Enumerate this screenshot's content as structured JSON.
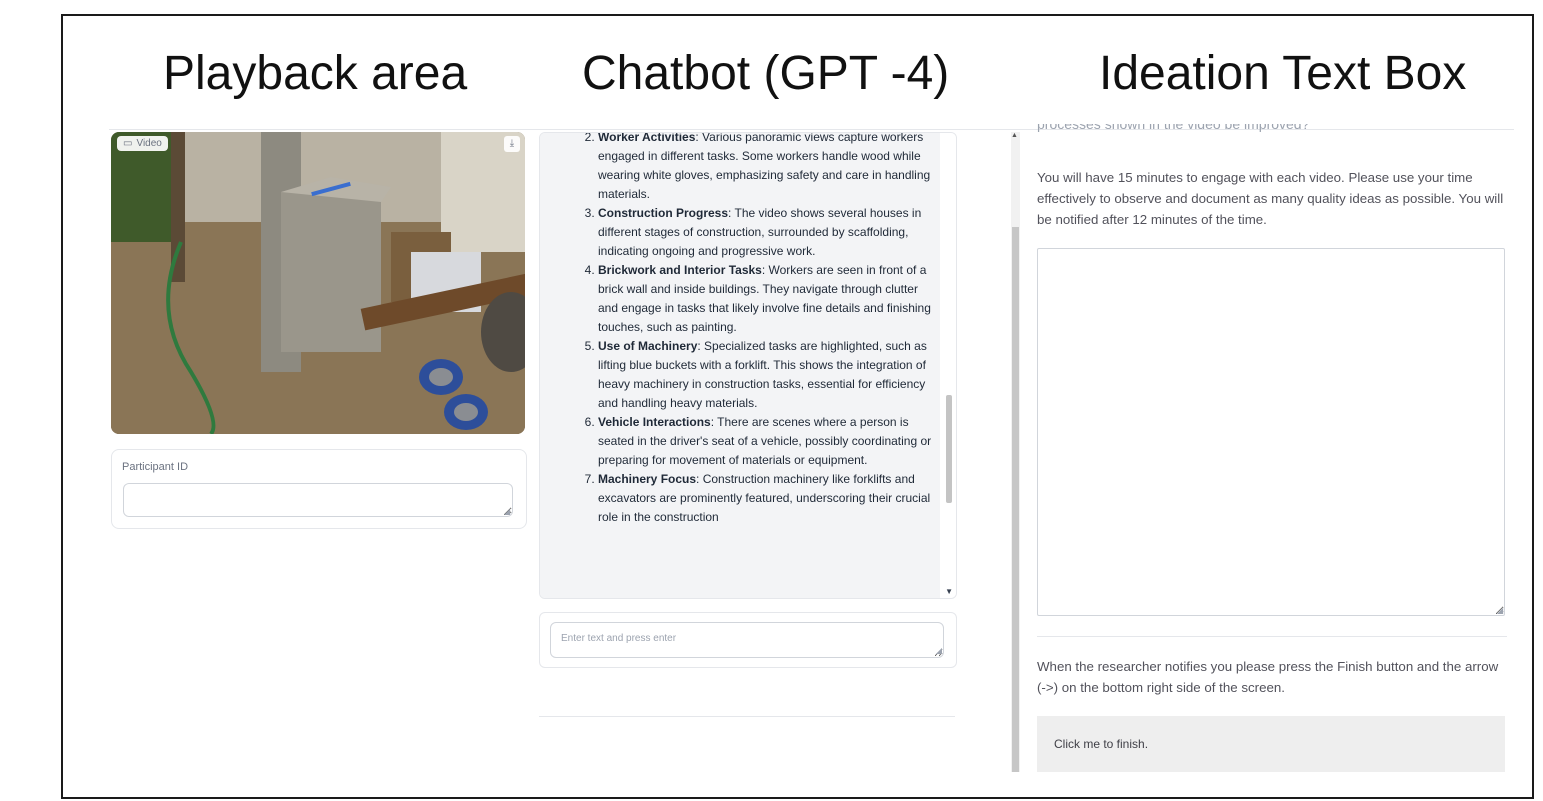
{
  "headings": {
    "playback": "Playback area",
    "chatbot": "Chatbot (GPT -4)",
    "ideation": "Ideation Text Box"
  },
  "video": {
    "label": "Video",
    "download_glyph": "⤓",
    "icon": "video-camera-icon"
  },
  "participant": {
    "label": "Participant ID",
    "value": ""
  },
  "chat": {
    "items": [
      {
        "num": "2",
        "title": "Worker Activities",
        "text": ": Various panoramic views capture workers engaged in different tasks. Some workers handle wood while wearing white gloves, emphasizing safety and care in handling materials."
      },
      {
        "num": "3",
        "title": "Construction Progress",
        "text": ": The video shows several houses in different stages of construction, surrounded by scaffolding, indicating ongoing and progressive work."
      },
      {
        "num": "4",
        "title": "Brickwork and Interior Tasks",
        "text": ": Workers are seen in front of a brick wall and inside buildings. They navigate through clutter and engage in tasks that likely involve fine details and finishing touches, such as painting."
      },
      {
        "num": "5",
        "title": "Use of Machinery",
        "text": ": Specialized tasks are highlighted, such as lifting blue buckets with a forklift. This shows the integration of heavy machinery in construction tasks, essential for efficiency and handling heavy materials."
      },
      {
        "num": "6",
        "title": "Vehicle Interactions",
        "text": ": There are scenes where a person is seated in the driver's seat of a vehicle, possibly coordinating or preparing for movement of materials or equipment."
      },
      {
        "num": "7",
        "title": "Machinery Focus",
        "text": ": Construction machinery like forklifts and excavators are prominently featured, underscoring their crucial role in the construction"
      }
    ],
    "input_placeholder": "Enter text and press enter"
  },
  "ideation": {
    "cut_text": "processes shown in the video be improved?",
    "instructions": "You will have 15 minutes to engage with each video. Please use your time effectively to observe and document as many quality ideas as possible. You will be notified after 12 minutes of the time.",
    "textarea_value": "",
    "finish_instructions": "When the researcher notifies you please press the Finish button and the arrow (->) on the bottom right side of the screen.",
    "finish_button": "Click me to finish."
  },
  "colors": {
    "border": "#1a1a1a",
    "panel_gray": "#f3f4f6",
    "button_gray": "#eeeeee"
  }
}
